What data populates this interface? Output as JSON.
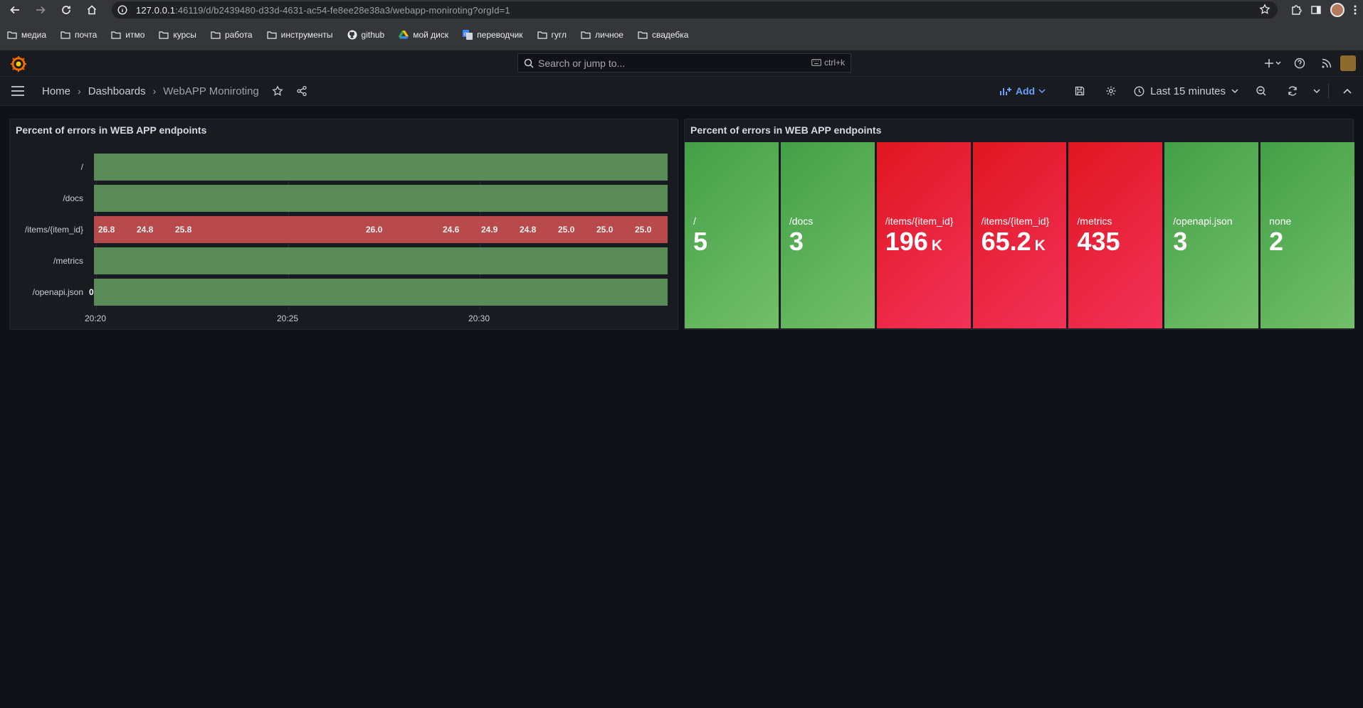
{
  "browser": {
    "url_host": "127.0.0.1",
    "url_rest": ":46119/d/b2439480-d33d-4631-ac54-fe8ee28e38a3/webapp-moniroting?orgId=1",
    "bookmarks": [
      {
        "label": "медиа",
        "icon": "folder-icon"
      },
      {
        "label": "почта",
        "icon": "folder-icon"
      },
      {
        "label": "итмо",
        "icon": "folder-icon"
      },
      {
        "label": "курсы",
        "icon": "folder-icon"
      },
      {
        "label": "работа",
        "icon": "folder-icon"
      },
      {
        "label": "инструменты",
        "icon": "folder-icon"
      },
      {
        "label": "github",
        "icon": "github-icon"
      },
      {
        "label": "мой диск",
        "icon": "drive-icon"
      },
      {
        "label": "переводчик",
        "icon": "translate-icon"
      },
      {
        "label": "гугл",
        "icon": "folder-icon"
      },
      {
        "label": "личное",
        "icon": "folder-icon"
      },
      {
        "label": "свадебка",
        "icon": "folder-icon"
      }
    ]
  },
  "topbar": {
    "search_placeholder": "Search or jump to...",
    "search_shortcut": "ctrl+k"
  },
  "nav": {
    "breadcrumbs": [
      "Home",
      "Dashboards",
      "WebAPP Moniroting"
    ],
    "add_label": "Add",
    "time_range": "Last 15 minutes"
  },
  "panels": {
    "history": {
      "title": "Percent of errors in WEB APP endpoints",
      "rows": [
        {
          "label": "/",
          "status": "ok"
        },
        {
          "label": "/docs",
          "status": "ok"
        },
        {
          "label": "/items/{item_id}",
          "status": "error"
        },
        {
          "label": "/metrics",
          "status": "ok"
        },
        {
          "label": "/openapi.json",
          "status": "ok"
        }
      ],
      "zero_label": "0",
      "x_ticks": [
        "20:20",
        "20:25",
        "20:30"
      ]
    },
    "stats": {
      "title": "Percent of errors in WEB APP endpoints"
    }
  },
  "chart_data": [
    {
      "type": "heatmap",
      "title": "Percent of errors in WEB APP endpoints",
      "categories": [
        "/",
        "/docs",
        "/items/{item_id}",
        "/metrics",
        "/openapi.json"
      ],
      "x_ticks": [
        "20:20",
        "20:25",
        "20:30"
      ],
      "series": [
        {
          "name": "/items/{item_id}",
          "values": [
            26.8,
            24.8,
            25.8,
            26.0,
            24.6,
            24.9,
            24.8,
            25.0,
            25.0,
            25.0
          ]
        }
      ],
      "colors": {
        "ok": "#5a8a58",
        "error": "#b84a4b"
      }
    },
    {
      "type": "table",
      "title": "Percent of errors in WEB APP endpoints",
      "tiles": [
        {
          "name": "/",
          "value": "5",
          "unit": "",
          "color": "green"
        },
        {
          "name": "/docs",
          "value": "3",
          "unit": "",
          "color": "green"
        },
        {
          "name": "/items/{item_id}",
          "value": "196",
          "unit": "K",
          "color": "red"
        },
        {
          "name": "/items/{item_id}",
          "value": "65.2",
          "unit": "K",
          "color": "red"
        },
        {
          "name": "/metrics",
          "value": "435",
          "unit": "",
          "color": "red"
        },
        {
          "name": "/openapi.json",
          "value": "3",
          "unit": "",
          "color": "green"
        },
        {
          "name": "none",
          "value": "2",
          "unit": "",
          "color": "green"
        }
      ]
    }
  ]
}
